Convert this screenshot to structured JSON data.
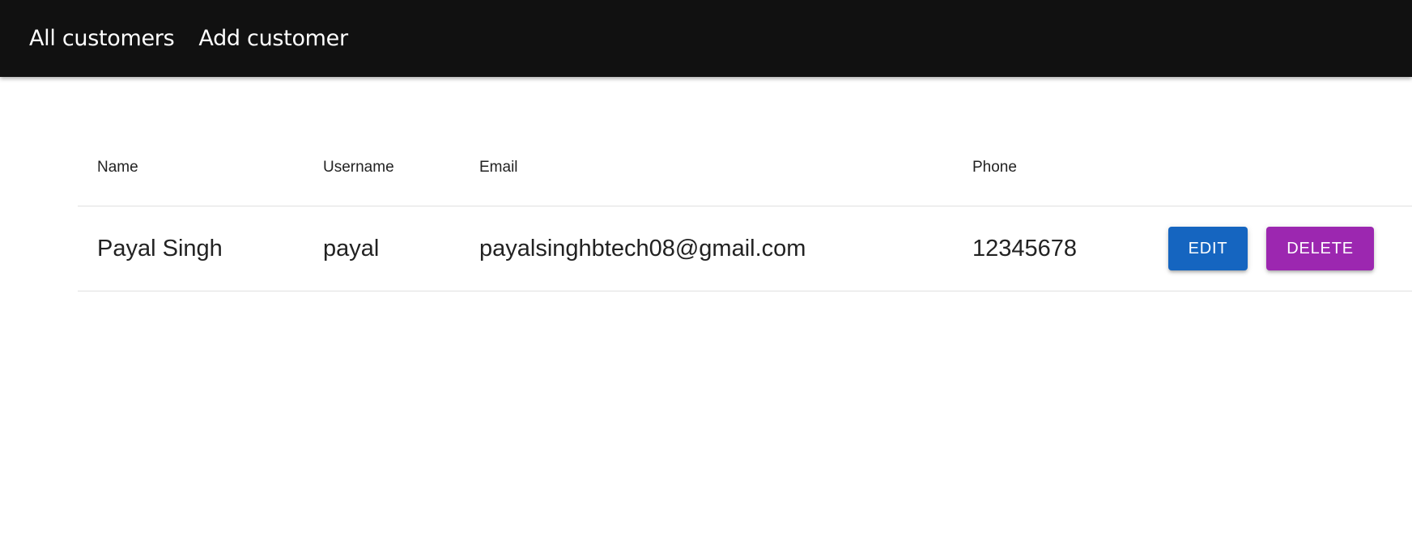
{
  "nav": {
    "all_customers": "All customers",
    "add_customer": "Add customer"
  },
  "table": {
    "headers": {
      "name": "Name",
      "username": "Username",
      "email": "Email",
      "phone": "Phone"
    },
    "rows": [
      {
        "name": "Payal Singh",
        "username": "payal",
        "email": "payalsinghbtech08@gmail.com",
        "phone": "12345678",
        "edit_label": "Edit",
        "delete_label": "Delete"
      }
    ]
  },
  "colors": {
    "appbar": "#111111",
    "edit_button": "#1565c0",
    "delete_button": "#9c27b0"
  }
}
